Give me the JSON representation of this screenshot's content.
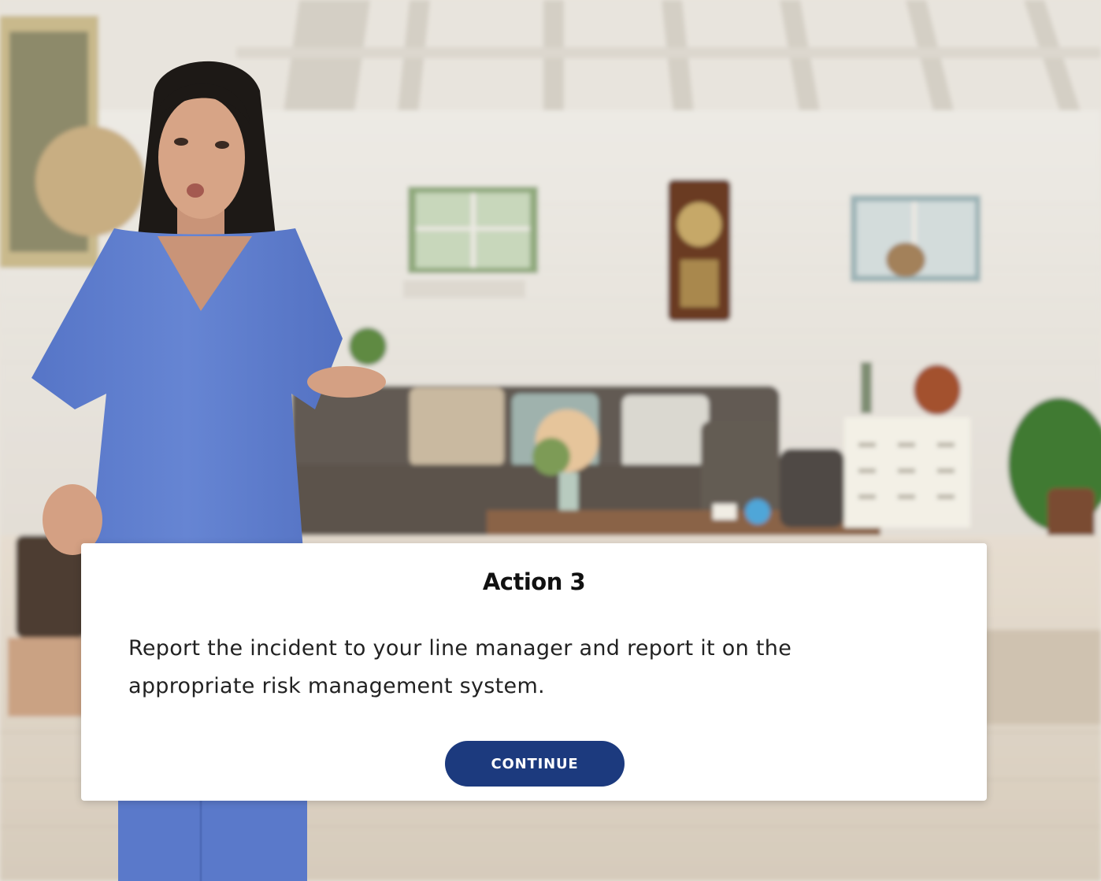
{
  "scene": {
    "background_icon": "living-room-photo",
    "character_icon": "nurse-character",
    "colors": {
      "wall": "#ecebe7",
      "ceiling": "#e7e3dc",
      "floor": "#ddd3c6",
      "sofa": "#5c544d",
      "scrubs": "#5f7fce",
      "clock": "#6b3a22"
    }
  },
  "dialog": {
    "title": "Action 3",
    "body": "Report the incident to your line manager and report it on the appropriate risk management system.",
    "continue_label": "CONTINUE",
    "colors": {
      "background": "#ffffff",
      "button": "#1c3a7e",
      "button_text": "#ffffff",
      "text": "#222222"
    }
  }
}
